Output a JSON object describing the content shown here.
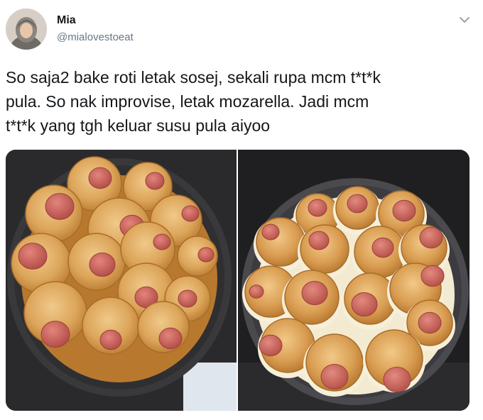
{
  "user": {
    "name": "Mia",
    "handle": "@mialovestoeat",
    "avatar_icon": "avatar-hijab-icon"
  },
  "menu": {
    "icon": "chevron-down-icon"
  },
  "tweet": {
    "text": "So saja2 bake roti letak sosej, sekali rupa mcm t*t*k\npula. So nak improvise, letak mozarella. Jadi mcm\nt*t*k yang tgh keluar susu pula aiyoo"
  },
  "colors": {
    "name": "#14171a",
    "handle": "#657786",
    "pan": "#3b3b3e",
    "bread": "#dca55a",
    "sausage": "#c9605a",
    "cheese": "#f3ead2"
  }
}
